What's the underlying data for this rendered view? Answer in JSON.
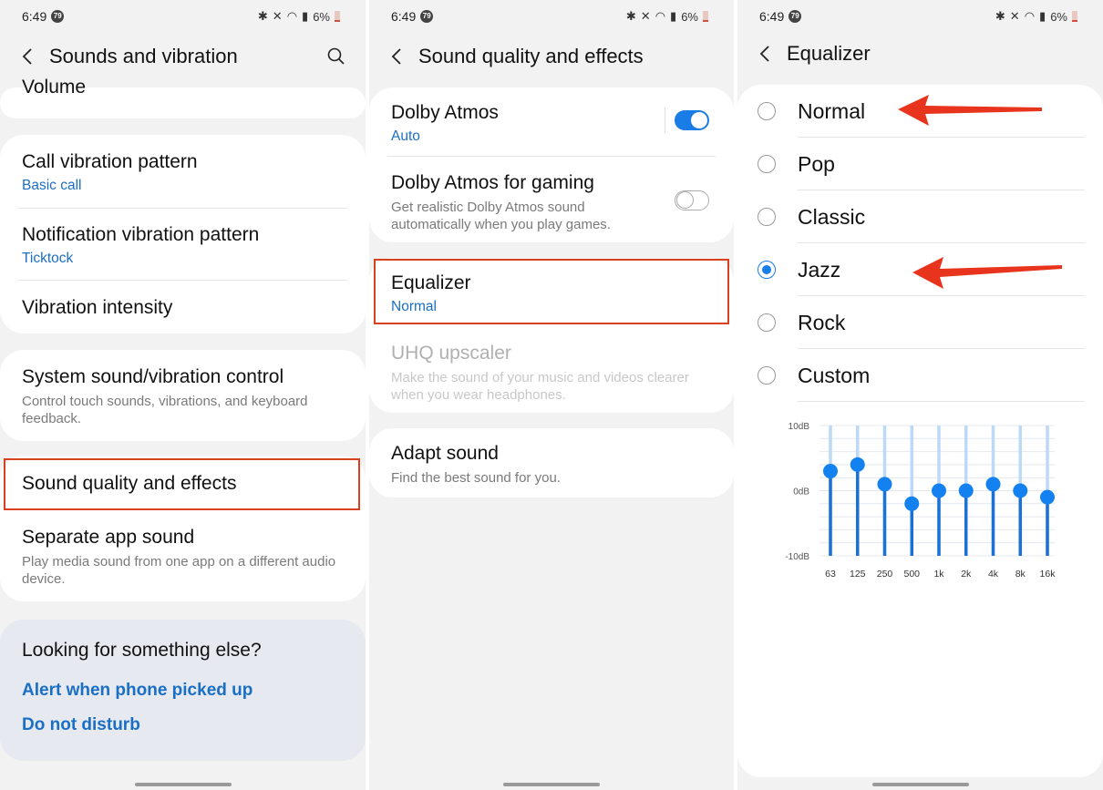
{
  "status_bar": {
    "time": "6:49",
    "notification_badge": "79",
    "battery": "6%"
  },
  "panel1": {
    "title": "Sounds and vibration",
    "partial_item": "Volume",
    "group1": [
      {
        "title": "Call vibration pattern",
        "value": "Basic call"
      },
      {
        "title": "Notification vibration pattern",
        "value": "Ticktock"
      },
      {
        "title": "Vibration intensity"
      }
    ],
    "system_item": {
      "title": "System sound/vibration control",
      "description": "Control touch sounds, vibrations, and keyboard feedback."
    },
    "group3": [
      {
        "title": "Sound quality and effects"
      },
      {
        "title": "Separate app sound",
        "description": "Play media sound from one app on a different audio device."
      }
    ],
    "suggestions": {
      "heading": "Looking for something else?",
      "links": [
        "Alert when phone picked up",
        "Do not disturb"
      ]
    }
  },
  "panel2": {
    "title": "Sound quality and effects",
    "dolby": {
      "title": "Dolby Atmos",
      "value": "Auto",
      "enabled": true
    },
    "dolby_gaming": {
      "title": "Dolby Atmos for gaming",
      "description": "Get realistic Dolby Atmos sound automatically when you play games.",
      "enabled": false
    },
    "equalizer": {
      "title": "Equalizer",
      "value": "Normal"
    },
    "uhq": {
      "title": "UHQ upscaler",
      "description": "Make the sound of your music and videos clearer when you wear headphones."
    },
    "adapt": {
      "title": "Adapt sound",
      "description": "Find the best sound for you."
    }
  },
  "panel3": {
    "title": "Equalizer",
    "presets": [
      "Normal",
      "Pop",
      "Classic",
      "Jazz",
      "Rock",
      "Custom"
    ],
    "selected": "Jazz"
  },
  "colors": {
    "accent": "#1a7ce6",
    "link": "#1a6fc4",
    "annotation": "#d9401f"
  },
  "chart_data": {
    "type": "bar",
    "title": "",
    "categories": [
      "63",
      "125",
      "250",
      "500",
      "1k",
      "2k",
      "4k",
      "8k",
      "16k"
    ],
    "values": [
      3,
      4,
      1,
      -2,
      0,
      0,
      1,
      0,
      -1
    ],
    "ytick_labels": [
      "10dB",
      "0dB",
      "-10dB"
    ],
    "ylim": [
      -10,
      10
    ],
    "xlabel": "",
    "ylabel": "",
    "grid": true
  }
}
